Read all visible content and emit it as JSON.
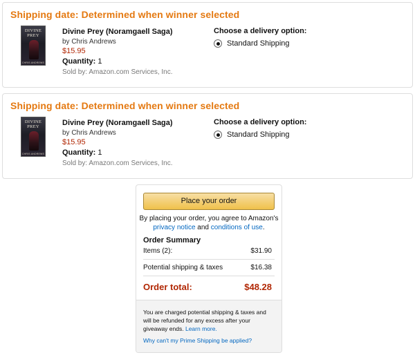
{
  "shipments": [
    {
      "shipping_date": "Shipping date: Determined when winner selected",
      "cover": {
        "title_line1": "DIVINE",
        "title_line2": "PREY",
        "author": "CHRIS ANDREWS"
      },
      "item": {
        "title": "Divine Prey (Noramgaell Saga)",
        "author": "by Chris Andrews",
        "price": "$15.95",
        "quantity_label": "Quantity:",
        "quantity_value": "1",
        "seller": "Sold by: Amazon.com Services, Inc."
      },
      "delivery": {
        "title": "Choose a delivery option:",
        "selected_option": "Standard Shipping"
      }
    },
    {
      "shipping_date": "Shipping date: Determined when winner selected",
      "cover": {
        "title_line1": "DIVINE",
        "title_line2": "PREY",
        "author": "CHRIS ANDREWS"
      },
      "item": {
        "title": "Divine Prey (Noramgaell Saga)",
        "author": "by Chris Andrews",
        "price": "$15.95",
        "quantity_label": "Quantity:",
        "quantity_value": "1",
        "seller": "Sold by: Amazon.com Services, Inc."
      },
      "delivery": {
        "title": "Choose a delivery option:",
        "selected_option": "Standard Shipping"
      }
    }
  ],
  "order": {
    "place_order_label": "Place your order",
    "agree_prefix": "By placing your order, you agree to Amazon's",
    "privacy_link": "privacy notice",
    "agree_and": "and",
    "conditions_link": "conditions of use",
    "agree_suffix": ".",
    "summary_title": "Order Summary",
    "items_label": "Items (2):",
    "items_value": "$31.90",
    "shipping_label": "Potential shipping & taxes",
    "shipping_value": "$16.38",
    "total_label": "Order total:",
    "total_value": "$48.28",
    "note": "You are charged potential shipping & taxes and will be refunded for any excess after your giveaway ends.",
    "learn_more": "Learn more.",
    "prime_link": "Why can't my Prime Shipping be applied?"
  },
  "colors": {
    "shipping_date": "#e47911",
    "price": "#b12704",
    "link": "#0066c0",
    "button": "#f0c14b"
  },
  "icons": {
    "radio": "radio-selected-icon"
  }
}
